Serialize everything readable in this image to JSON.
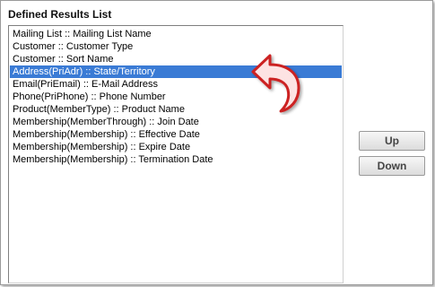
{
  "panel": {
    "title": "Defined Results List"
  },
  "list": {
    "items": [
      "Mailing List :: Mailing List Name",
      "Customer :: Customer Type",
      "Customer :: Sort Name",
      "Address(PriAdr) :: State/Territory",
      "Email(PriEmail) :: E-Mail Address",
      "Phone(PriPhone) :: Phone Number",
      "Product(MemberType) :: Product Name",
      "Membership(MemberThrough) :: Join Date",
      "Membership(Membership) :: Effective Date",
      "Membership(Membership) :: Expire Date",
      "Membership(Membership) :: Termination Date"
    ],
    "selected_index": 3
  },
  "buttons": {
    "up_label": "Up",
    "down_label": "Down"
  },
  "colors": {
    "selection": "#3a7bd5",
    "arrow_fill": "#fde3e3",
    "arrow_stroke": "#cc2222"
  },
  "annotation": {
    "icon": "curved-arrow-icon"
  }
}
